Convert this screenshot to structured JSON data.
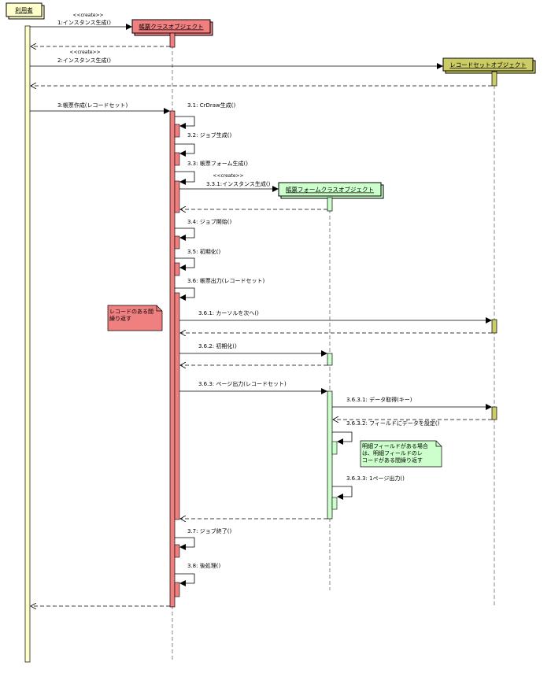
{
  "colors": {
    "user": "#ffffcc",
    "report": "#f08080",
    "recordset": "#cccc66",
    "form": "#ccffcc",
    "line": "#000000"
  },
  "objects": {
    "user": "利用者",
    "report": "帳票クラスオブジェクト",
    "recordset": "レコードセットオブジェクト",
    "form": "帳票フォームクラスオブジェクト"
  },
  "stereotype": "<<create>>",
  "messages": {
    "m1": "1:インスタンス生成()",
    "m2": "2:インスタンス生成()",
    "m3": "3:帳票作成(レコードセット)",
    "m31": "3.1: CrDraw生成()",
    "m32": "3.2: ジョブ生成()",
    "m33": "3.3: 帳票フォーム生成()",
    "m331": "3.3.1:インスタンス生成()",
    "m34": "3.4: ジョブ開始()",
    "m35": "3.5: 初期化()",
    "m36": "3.6: 帳票出力(レコードセット)",
    "m361": "3.6.1: カーソルを次へ()",
    "m362": "3.6.2: 初期化()",
    "m363": "3.6.3: ページ出力(レコードセット)",
    "m3631": "3.6.3.1: データ取得(キー)",
    "m3632": "3.6.3.2: フィールドにデータを設定()",
    "m3633": "3.6.3.3: 1ページ出力()",
    "m37": "3.7: ジョブ終了()",
    "m38": "3.8: 後処理()"
  },
  "notes": {
    "loop_record": [
      "レコードのある間",
      "繰り返す"
    ],
    "loop_detail": [
      "明細フィールドがある場合",
      "は、明細フィールドのレ",
      "コードがある間繰り返す"
    ]
  }
}
